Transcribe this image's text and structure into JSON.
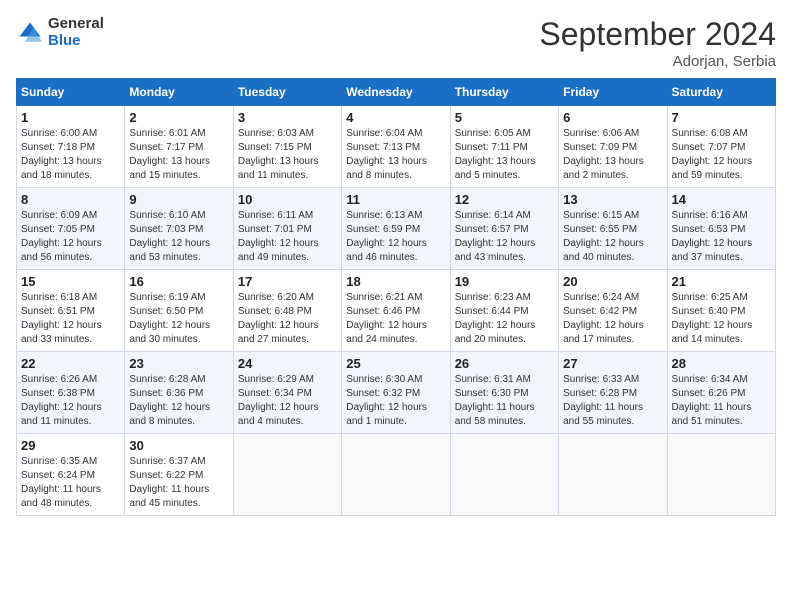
{
  "header": {
    "logo_general": "General",
    "logo_blue": "Blue",
    "title": "September 2024",
    "location": "Adorjan, Serbia"
  },
  "columns": [
    "Sunday",
    "Monday",
    "Tuesday",
    "Wednesday",
    "Thursday",
    "Friday",
    "Saturday"
  ],
  "weeks": [
    [
      {
        "day": "1",
        "info": "Sunrise: 6:00 AM\nSunset: 7:18 PM\nDaylight: 13 hours\nand 18 minutes."
      },
      {
        "day": "2",
        "info": "Sunrise: 6:01 AM\nSunset: 7:17 PM\nDaylight: 13 hours\nand 15 minutes."
      },
      {
        "day": "3",
        "info": "Sunrise: 6:03 AM\nSunset: 7:15 PM\nDaylight: 13 hours\nand 11 minutes."
      },
      {
        "day": "4",
        "info": "Sunrise: 6:04 AM\nSunset: 7:13 PM\nDaylight: 13 hours\nand 8 minutes."
      },
      {
        "day": "5",
        "info": "Sunrise: 6:05 AM\nSunset: 7:11 PM\nDaylight: 13 hours\nand 5 minutes."
      },
      {
        "day": "6",
        "info": "Sunrise: 6:06 AM\nSunset: 7:09 PM\nDaylight: 13 hours\nand 2 minutes."
      },
      {
        "day": "7",
        "info": "Sunrise: 6:08 AM\nSunset: 7:07 PM\nDaylight: 12 hours\nand 59 minutes."
      }
    ],
    [
      {
        "day": "8",
        "info": "Sunrise: 6:09 AM\nSunset: 7:05 PM\nDaylight: 12 hours\nand 56 minutes."
      },
      {
        "day": "9",
        "info": "Sunrise: 6:10 AM\nSunset: 7:03 PM\nDaylight: 12 hours\nand 53 minutes."
      },
      {
        "day": "10",
        "info": "Sunrise: 6:11 AM\nSunset: 7:01 PM\nDaylight: 12 hours\nand 49 minutes."
      },
      {
        "day": "11",
        "info": "Sunrise: 6:13 AM\nSunset: 6:59 PM\nDaylight: 12 hours\nand 46 minutes."
      },
      {
        "day": "12",
        "info": "Sunrise: 6:14 AM\nSunset: 6:57 PM\nDaylight: 12 hours\nand 43 minutes."
      },
      {
        "day": "13",
        "info": "Sunrise: 6:15 AM\nSunset: 6:55 PM\nDaylight: 12 hours\nand 40 minutes."
      },
      {
        "day": "14",
        "info": "Sunrise: 6:16 AM\nSunset: 6:53 PM\nDaylight: 12 hours\nand 37 minutes."
      }
    ],
    [
      {
        "day": "15",
        "info": "Sunrise: 6:18 AM\nSunset: 6:51 PM\nDaylight: 12 hours\nand 33 minutes."
      },
      {
        "day": "16",
        "info": "Sunrise: 6:19 AM\nSunset: 6:50 PM\nDaylight: 12 hours\nand 30 minutes."
      },
      {
        "day": "17",
        "info": "Sunrise: 6:20 AM\nSunset: 6:48 PM\nDaylight: 12 hours\nand 27 minutes."
      },
      {
        "day": "18",
        "info": "Sunrise: 6:21 AM\nSunset: 6:46 PM\nDaylight: 12 hours\nand 24 minutes."
      },
      {
        "day": "19",
        "info": "Sunrise: 6:23 AM\nSunset: 6:44 PM\nDaylight: 12 hours\nand 20 minutes."
      },
      {
        "day": "20",
        "info": "Sunrise: 6:24 AM\nSunset: 6:42 PM\nDaylight: 12 hours\nand 17 minutes."
      },
      {
        "day": "21",
        "info": "Sunrise: 6:25 AM\nSunset: 6:40 PM\nDaylight: 12 hours\nand 14 minutes."
      }
    ],
    [
      {
        "day": "22",
        "info": "Sunrise: 6:26 AM\nSunset: 6:38 PM\nDaylight: 12 hours\nand 11 minutes."
      },
      {
        "day": "23",
        "info": "Sunrise: 6:28 AM\nSunset: 6:36 PM\nDaylight: 12 hours\nand 8 minutes."
      },
      {
        "day": "24",
        "info": "Sunrise: 6:29 AM\nSunset: 6:34 PM\nDaylight: 12 hours\nand 4 minutes."
      },
      {
        "day": "25",
        "info": "Sunrise: 6:30 AM\nSunset: 6:32 PM\nDaylight: 12 hours\nand 1 minute."
      },
      {
        "day": "26",
        "info": "Sunrise: 6:31 AM\nSunset: 6:30 PM\nDaylight: 11 hours\nand 58 minutes."
      },
      {
        "day": "27",
        "info": "Sunrise: 6:33 AM\nSunset: 6:28 PM\nDaylight: 11 hours\nand 55 minutes."
      },
      {
        "day": "28",
        "info": "Sunrise: 6:34 AM\nSunset: 6:26 PM\nDaylight: 11 hours\nand 51 minutes."
      }
    ],
    [
      {
        "day": "29",
        "info": "Sunrise: 6:35 AM\nSunset: 6:24 PM\nDaylight: 11 hours\nand 48 minutes."
      },
      {
        "day": "30",
        "info": "Sunrise: 6:37 AM\nSunset: 6:22 PM\nDaylight: 11 hours\nand 45 minutes."
      },
      {
        "day": "",
        "info": ""
      },
      {
        "day": "",
        "info": ""
      },
      {
        "day": "",
        "info": ""
      },
      {
        "day": "",
        "info": ""
      },
      {
        "day": "",
        "info": ""
      }
    ]
  ]
}
